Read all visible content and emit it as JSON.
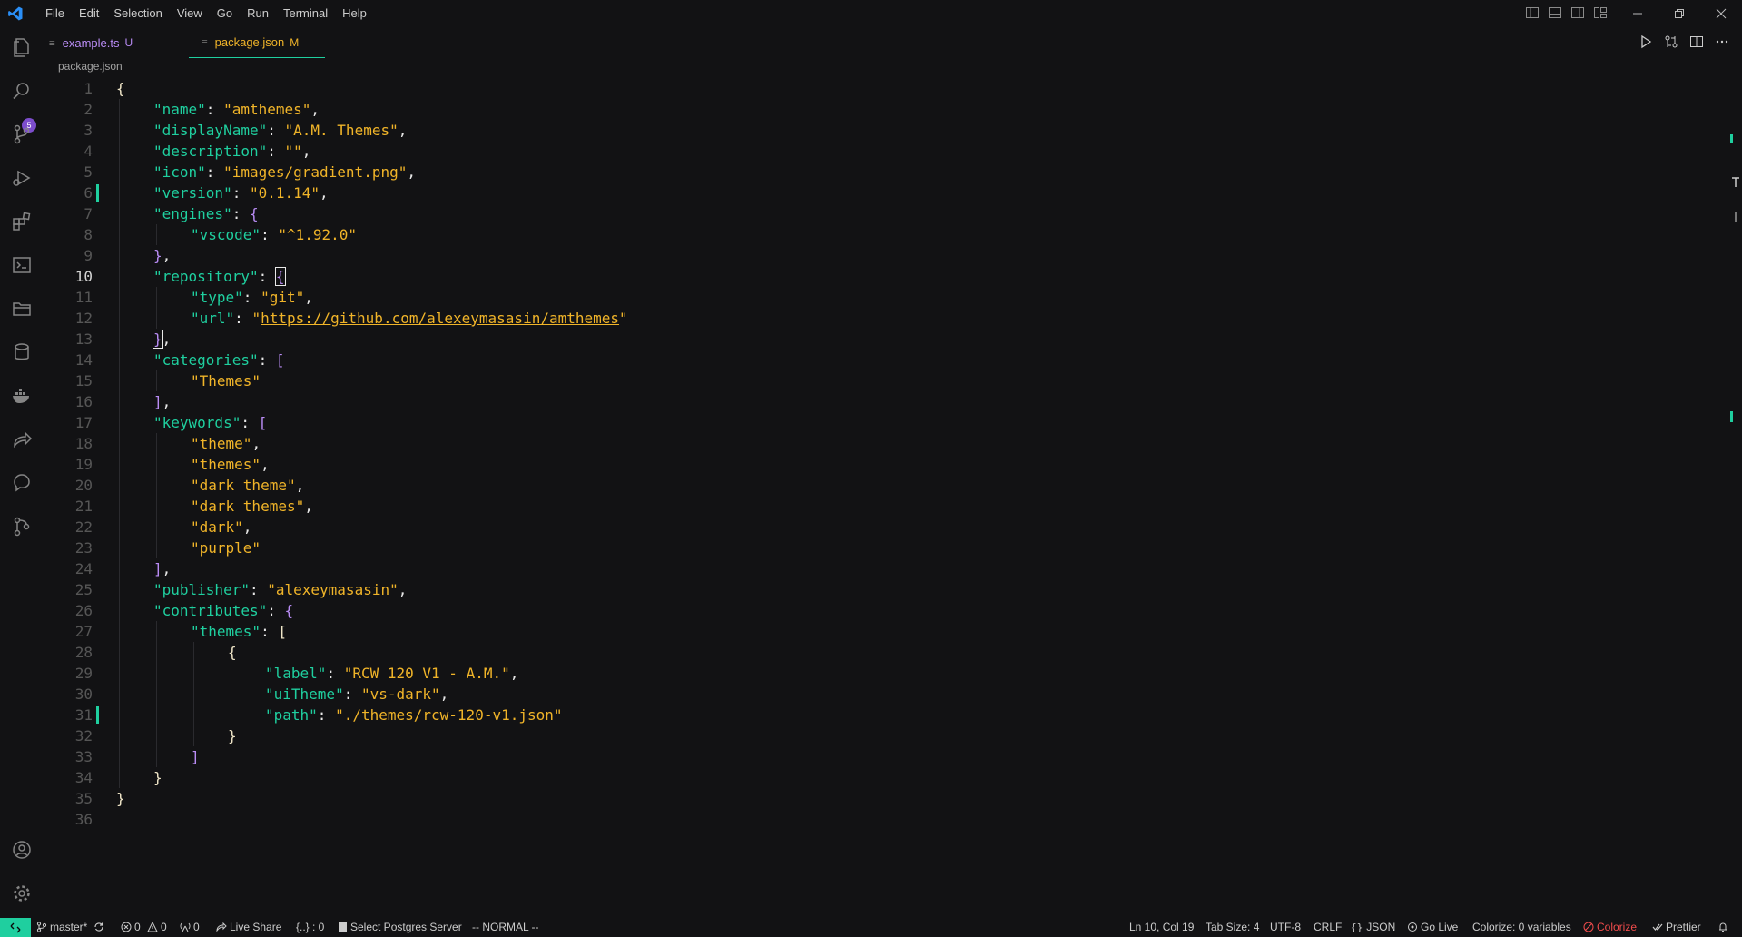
{
  "menu": [
    "File",
    "Edit",
    "Selection",
    "View",
    "Go",
    "Run",
    "Terminal",
    "Help"
  ],
  "activity": {
    "search_badge": "5"
  },
  "tabs": [
    {
      "label": "example.ts",
      "status": "U"
    },
    {
      "label": "package.json",
      "status": "M"
    }
  ],
  "breadcrumb": "package.json",
  "cursor_line": 10,
  "code_lines": [
    [
      [
        "br",
        "{"
      ]
    ],
    [
      [
        "k",
        "\"name\""
      ],
      [
        "p",
        ": "
      ],
      [
        "s",
        "\"amthemes\""
      ],
      [
        "p",
        ","
      ]
    ],
    [
      [
        "k",
        "\"displayName\""
      ],
      [
        "p",
        ": "
      ],
      [
        "s",
        "\"A.M. Themes\""
      ],
      [
        "p",
        ","
      ]
    ],
    [
      [
        "k",
        "\"description\""
      ],
      [
        "p",
        ": "
      ],
      [
        "s",
        "\"\""
      ],
      [
        "p",
        ","
      ]
    ],
    [
      [
        "k",
        "\"icon\""
      ],
      [
        "p",
        ": "
      ],
      [
        "s",
        "\"images/gradient.png\""
      ],
      [
        "p",
        ","
      ]
    ],
    [
      [
        "k",
        "\"version\""
      ],
      [
        "p",
        ": "
      ],
      [
        "s",
        "\"0.1.14\""
      ],
      [
        "p",
        ","
      ]
    ],
    [
      [
        "k",
        "\"engines\""
      ],
      [
        "p",
        ": "
      ],
      [
        "br-v",
        "{"
      ]
    ],
    [
      [
        "k",
        "\"vscode\""
      ],
      [
        "p",
        ": "
      ],
      [
        "s",
        "\"^1.92.0\""
      ]
    ],
    [
      [
        "br-v",
        "}"
      ],
      [
        "p",
        ","
      ]
    ],
    [
      [
        "k",
        "\"repository\""
      ],
      [
        "p",
        ": "
      ],
      [
        "cursor-br br-v",
        "{"
      ]
    ],
    [
      [
        "k",
        "\"type\""
      ],
      [
        "p",
        ": "
      ],
      [
        "s",
        "\"git\""
      ],
      [
        "p",
        ","
      ]
    ],
    [
      [
        "k",
        "\"url\""
      ],
      [
        "p",
        ": "
      ],
      [
        "s",
        "\""
      ],
      [
        "u",
        "https://github.com/alexeymasasin/amthemes"
      ],
      [
        "s",
        "\""
      ]
    ],
    [
      [
        "cursor-br br-v",
        "}"
      ],
      [
        "p",
        ","
      ]
    ],
    [
      [
        "k",
        "\"categories\""
      ],
      [
        "p",
        ": "
      ],
      [
        "br-v",
        "["
      ]
    ],
    [
      [
        "s",
        "\"Themes\""
      ]
    ],
    [
      [
        "br-v",
        "]"
      ],
      [
        "p",
        ","
      ]
    ],
    [
      [
        "k",
        "\"keywords\""
      ],
      [
        "p",
        ": "
      ],
      [
        "br-v",
        "["
      ]
    ],
    [
      [
        "s",
        "\"theme\""
      ],
      [
        "p",
        ","
      ]
    ],
    [
      [
        "s",
        "\"themes\""
      ],
      [
        "p",
        ","
      ]
    ],
    [
      [
        "s",
        "\"dark theme\""
      ],
      [
        "p",
        ","
      ]
    ],
    [
      [
        "s",
        "\"dark themes\""
      ],
      [
        "p",
        ","
      ]
    ],
    [
      [
        "s",
        "\"dark\""
      ],
      [
        "p",
        ","
      ]
    ],
    [
      [
        "s",
        "\"purple\""
      ]
    ],
    [
      [
        "br-v",
        "]"
      ],
      [
        "p",
        ","
      ]
    ],
    [
      [
        "k",
        "\"publisher\""
      ],
      [
        "p",
        ": "
      ],
      [
        "s",
        "\"alexeymasasin\""
      ],
      [
        "p",
        ","
      ]
    ],
    [
      [
        "k",
        "\"contributes\""
      ],
      [
        "p",
        ": "
      ],
      [
        "br-v",
        "{"
      ]
    ],
    [
      [
        "k",
        "\"themes\""
      ],
      [
        "p",
        ": "
      ],
      [
        "br",
        "["
      ]
    ],
    [
      [
        "br",
        "{"
      ]
    ],
    [
      [
        "k",
        "\"label\""
      ],
      [
        "p",
        ": "
      ],
      [
        "s",
        "\"RCW 120 V1 - A.M.\""
      ],
      [
        "p",
        ","
      ]
    ],
    [
      [
        "k",
        "\"uiTheme\""
      ],
      [
        "p",
        ": "
      ],
      [
        "s",
        "\"vs-dark\""
      ],
      [
        "p",
        ","
      ]
    ],
    [
      [
        "k",
        "\"path\""
      ],
      [
        "p",
        ": "
      ],
      [
        "s",
        "\"./themes/rcw-120-v1.json\""
      ]
    ],
    [
      [
        "br",
        "}"
      ]
    ],
    [
      [
        "br-v",
        "]"
      ]
    ],
    [
      [
        "br",
        "}"
      ]
    ],
    [
      [
        "br",
        "}"
      ]
    ],
    []
  ],
  "code_indent": [
    0,
    1,
    1,
    1,
    1,
    1,
    1,
    2,
    1,
    1,
    2,
    2,
    1,
    1,
    2,
    1,
    1,
    2,
    2,
    2,
    2,
    2,
    2,
    1,
    1,
    1,
    2,
    3,
    4,
    4,
    4,
    3,
    2,
    1,
    0,
    0
  ],
  "modified_lines": [
    6,
    31
  ],
  "statusbar": {
    "branch": "master*",
    "errors": "0",
    "warnings": "0",
    "ports": "0",
    "live_share": "Live Share",
    "braces": "{..} : 0",
    "postgres": "Select Postgres Server",
    "mode": "-- NORMAL --",
    "position": "Ln 10, Col 19",
    "tab_size": "Tab Size: 4",
    "encoding": "UTF-8",
    "eol": "CRLF",
    "language": "JSON",
    "go_live": "Go Live",
    "colorize_vars": "Colorize: 0 variables",
    "colorize": "Colorize",
    "prettier": "Prettier"
  },
  "colors": {
    "accent": "#1fcf9f",
    "string": "#f0b429",
    "bracket": "#b98cf5",
    "error": "#f14c4c",
    "tab_active": "#f0b429",
    "tab_inactive": "#b98cf5"
  }
}
